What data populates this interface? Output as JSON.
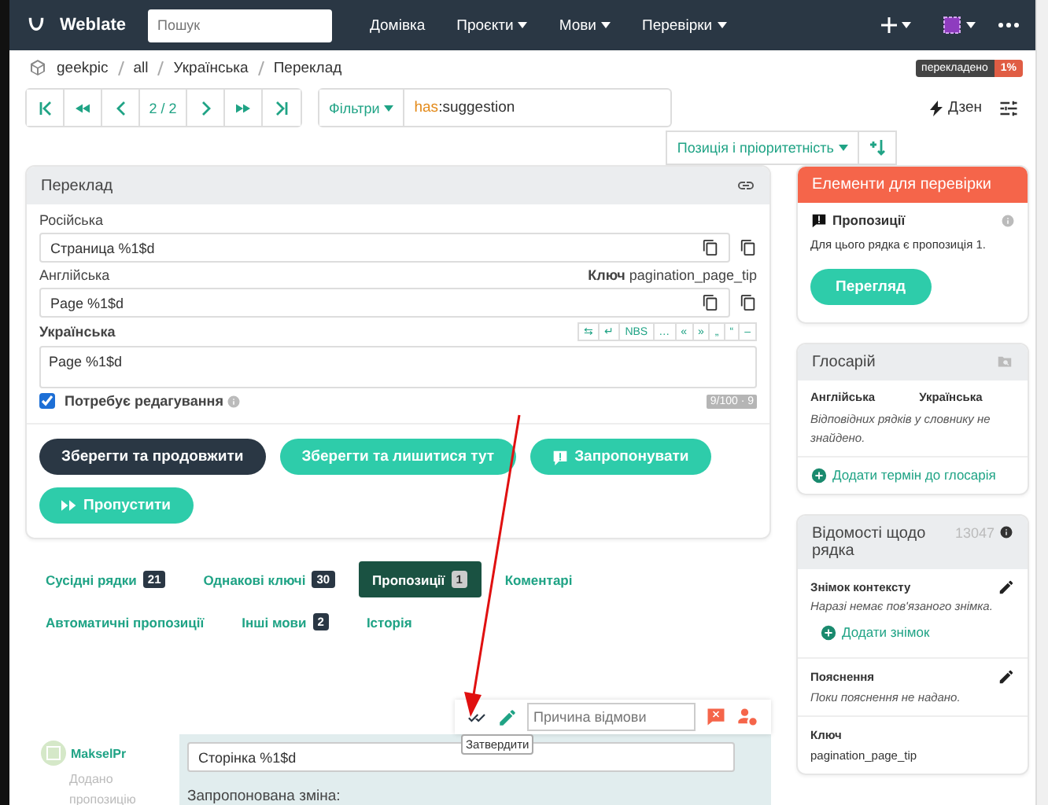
{
  "navbar": {
    "brand": "Weblate",
    "search_placeholder": "Пошук",
    "menu": [
      {
        "label": "Домівка",
        "dropdown": false
      },
      {
        "label": "Проєкти",
        "dropdown": true
      },
      {
        "label": "Мови",
        "dropdown": true
      },
      {
        "label": "Перевірки",
        "dropdown": true
      }
    ]
  },
  "breadcrumb": [
    "geekpic",
    "all",
    "Українська",
    "Переклад"
  ],
  "progress_badge": {
    "label": "перекладено",
    "value": "1%"
  },
  "pager": {
    "position": "2 / 2"
  },
  "filter": {
    "button": "Фільтри",
    "query_key": "has",
    "query_rest": ":suggestion"
  },
  "zen": "Дзен",
  "sort": {
    "label": "Позиція і пріоритетність"
  },
  "translation_panel": {
    "title": "Переклад",
    "source_label": "Російська",
    "source_text": "Страница %1$d",
    "english_label": "Англійська",
    "key_label": "Ключ",
    "key_value": "pagination_page_tip",
    "english_text": "Page %1$d",
    "target_label": "Українська",
    "special_chars": [
      "⇆",
      "↵",
      "NBS",
      "…",
      "«",
      "»",
      "„",
      "“",
      "–"
    ],
    "target_text": "Page %1$d",
    "needs_editing": {
      "label": "Потребує редагування",
      "checked": true
    },
    "counter": "9/100 · 9",
    "buttons": [
      {
        "label": "Зберегти та продовжити",
        "kind": "save"
      },
      {
        "label": "Зберегти та лишитися тут",
        "kind": "stay"
      },
      {
        "label": "Запропонувати",
        "kind": "suggest"
      },
      {
        "label": "Пропустити",
        "kind": "skip"
      }
    ]
  },
  "tabs": [
    {
      "label": "Сусідні рядки",
      "count": "21",
      "selected": false
    },
    {
      "label": "Однакові ключі",
      "count": "30",
      "selected": false
    },
    {
      "label": "Пропозиції",
      "count": "1",
      "selected": true
    },
    {
      "label": "Коментарі",
      "selected": false
    },
    {
      "label": "Автоматичні пропозиції",
      "selected": false
    },
    {
      "label": "Інші мови",
      "count": "2",
      "selected": false
    },
    {
      "label": "Історія",
      "selected": false
    }
  ],
  "suggestion": {
    "reject_placeholder": "Причина відмови",
    "tooltip": "Затвердити",
    "author": "MakselPr",
    "action": "Додано пропозицію",
    "text": "Сторінка %1$d",
    "change_label": "Запропонована зміна:"
  },
  "checks_panel": {
    "title": "Елементи для перевірки",
    "check_title": "Пропозиції",
    "check_text": "Для цього рядка є пропозиція 1.",
    "review_button": "Перегляд"
  },
  "glossary": {
    "title": "Глосарій",
    "columns": [
      "Англійська",
      "Українська"
    ],
    "empty": "Відповідних рядків у словнику не знайдено.",
    "add": "Додати термін до глосарія"
  },
  "string_info": {
    "title": "Відомості щодо рядка",
    "id": "13047",
    "screenshot_label": "Знімок контексту",
    "screenshot_text": "Наразі немає пов'язаного знімка.",
    "add_screenshot": "Додати знімок",
    "explanation_label": "Пояснення",
    "explanation_text": "Поки пояснення не надано.",
    "key_label": "Ключ",
    "key_value": "pagination_page_tip"
  }
}
